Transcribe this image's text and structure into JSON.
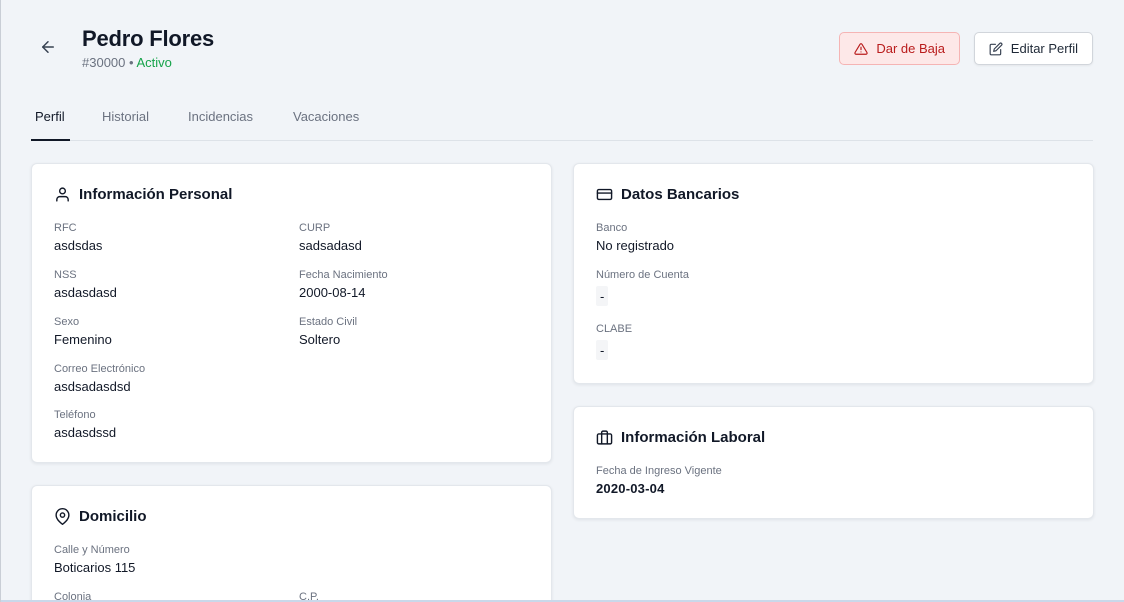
{
  "header": {
    "name": "Pedro Flores",
    "employee_id": "#30000",
    "separator": "•",
    "status": "Activo",
    "dismiss_label": "Dar de Baja",
    "edit_label": "Editar Perfil"
  },
  "tabs": [
    {
      "label": "Perfil",
      "active": true
    },
    {
      "label": "Historial",
      "active": false
    },
    {
      "label": "Incidencias",
      "active": false
    },
    {
      "label": "Vacaciones",
      "active": false
    }
  ],
  "personal": {
    "title": "Información Personal",
    "icon": "user-icon",
    "fields": [
      {
        "label": "RFC",
        "value": "asdsdas"
      },
      {
        "label": "CURP",
        "value": "sadsadasd"
      },
      {
        "label": "NSS",
        "value": "asdasdasd"
      },
      {
        "label": "Fecha Nacimiento",
        "value": "2000-08-14"
      },
      {
        "label": "Sexo",
        "value": "Femenino"
      },
      {
        "label": "Estado Civil",
        "value": "Soltero"
      },
      {
        "label": "Correo Electrónico",
        "value": "asdsadasdsd"
      },
      {
        "label": "Teléfono",
        "value": "asdasdssd"
      }
    ]
  },
  "address": {
    "title": "Domicilio",
    "icon": "map-pin-icon",
    "fields": [
      {
        "label": "Calle y Número",
        "value": "Boticarios 115"
      },
      {
        "label": "Colonia",
        "value": ""
      },
      {
        "label": "C.P.",
        "value": ""
      }
    ]
  },
  "bank": {
    "title": "Datos Bancarios",
    "icon": "credit-card-icon",
    "fields": [
      {
        "label": "Banco",
        "value": "No registrado"
      },
      {
        "label": "Número de Cuenta",
        "value": "-"
      },
      {
        "label": "CLABE",
        "value": "-"
      }
    ]
  },
  "work": {
    "title": "Información Laboral",
    "icon": "briefcase-icon",
    "fields": [
      {
        "label": "Fecha de Ingreso Vigente",
        "value": "2020-03-04"
      }
    ]
  },
  "colors": {
    "background": "#f1f4f8",
    "status_active": "#16a34a",
    "danger_text": "#b91c1c",
    "danger_bg": "#fde8e8"
  }
}
